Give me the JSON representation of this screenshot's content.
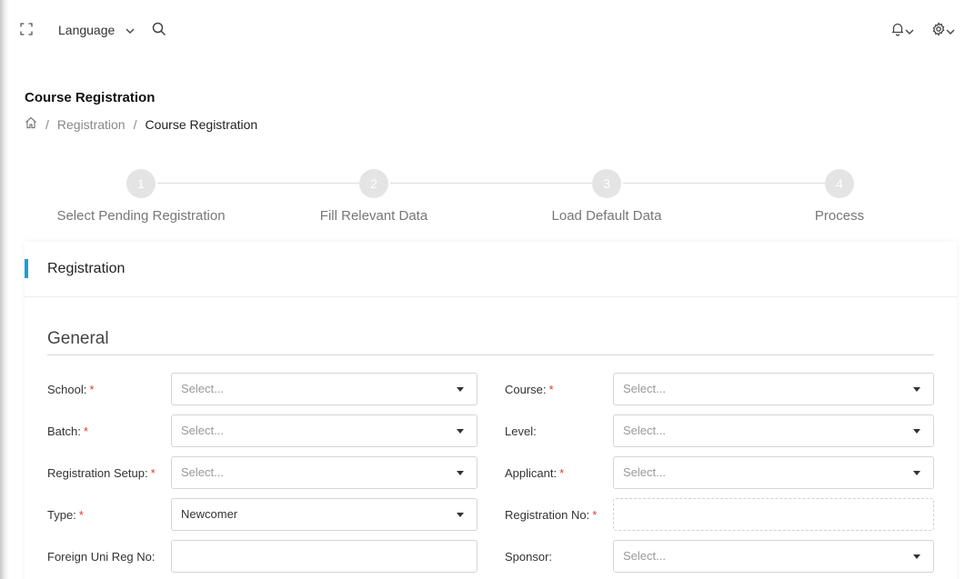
{
  "topbar": {
    "fullscreen_icon": "fullscreen-icon",
    "language_label": "Language",
    "search_icon": "search-icon",
    "bell_icon": "bell-icon",
    "settings_icon": "gear-icon"
  },
  "page": {
    "title": "Course Registration"
  },
  "breadcrumb": {
    "home_icon": "home-icon",
    "items": [
      "Registration",
      "Course Registration"
    ],
    "separator": "/"
  },
  "steps": [
    {
      "number": "1",
      "label": "Select Pending Registration"
    },
    {
      "number": "2",
      "label": "Fill Relevant Data"
    },
    {
      "number": "3",
      "label": "Load Default Data"
    },
    {
      "number": "4",
      "label": "Process"
    }
  ],
  "card": {
    "title": "Registration",
    "accent_color": "#1a9fd9"
  },
  "section": {
    "title": "General"
  },
  "form": {
    "school": {
      "label": "School:",
      "required": "*",
      "value": "Select..."
    },
    "course": {
      "label": "Course:",
      "required": "*",
      "value": "Select..."
    },
    "batch": {
      "label": "Batch:",
      "required": "*",
      "value": "Select..."
    },
    "level": {
      "label": "Level:",
      "value": "Select..."
    },
    "registration_setup": {
      "label": "Registration Setup:",
      "required": "*",
      "value": "Select..."
    },
    "applicant": {
      "label": "Applicant:",
      "required": "*",
      "value": "Select..."
    },
    "type": {
      "label": "Type:",
      "required": "*",
      "value": "Newcomer"
    },
    "registration_no": {
      "label": "Registration No:",
      "required": "*",
      "value": ""
    },
    "foreign_uni_reg_no": {
      "label": "Foreign Uni Reg No:",
      "value": ""
    },
    "sponsor": {
      "label": "Sponsor:",
      "value": "Select..."
    }
  }
}
